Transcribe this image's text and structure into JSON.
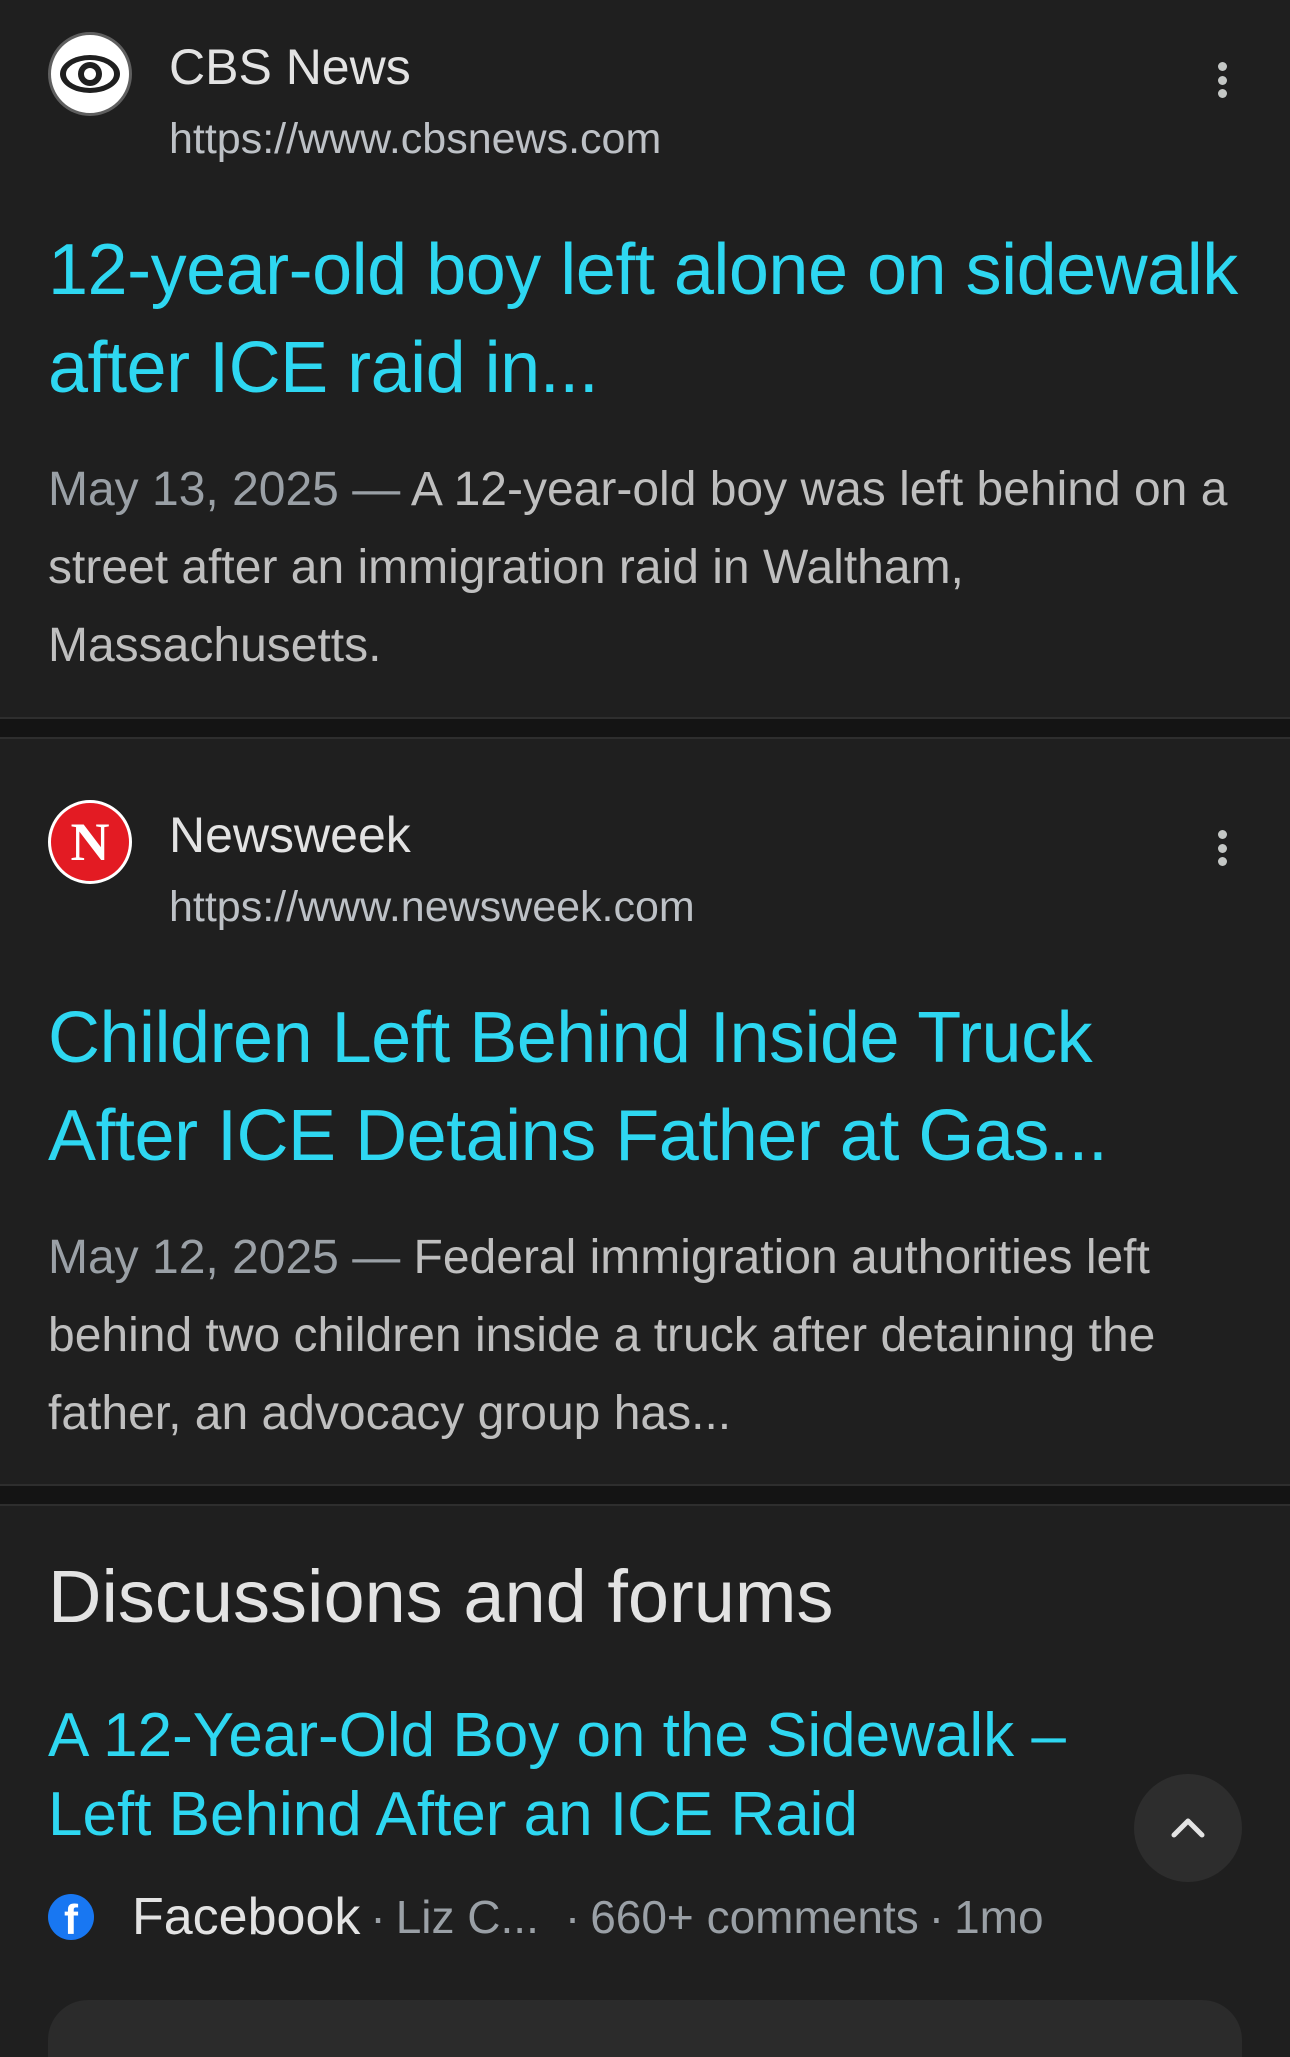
{
  "results": [
    {
      "site_name": "CBS News",
      "url": "https://www.cbsnews.com",
      "favicon_icon": "cbs-eye-icon",
      "title": "12-year-old boy left alone on sidewalk after ICE raid in...",
      "date": "May 13, 2025",
      "dash": " — ",
      "snippet": "A 12-year-old boy was left behind on a street after an immigration raid in Waltham, Massachusetts."
    },
    {
      "site_name": "Newsweek",
      "url": "https://www.newsweek.com",
      "favicon_icon": "newsweek-n-icon",
      "favicon_letter": "N",
      "title": "Children Left Behind Inside Truck After ICE Detains Father at Gas...",
      "date": "May 12, 2025",
      "dash": " — ",
      "snippet": "Federal immigration authorities left behind two children inside a truck after detaining the father, an advocacy group has..."
    }
  ],
  "discussions": {
    "heading": "Discussions and forums",
    "item": {
      "title": "A 12-Year-Old Boy on the Sidewalk – Left Behind After an ICE Raid",
      "platform_icon": "facebook-icon",
      "platform_letter": "f",
      "platform": "Facebook",
      "author": "Liz C...",
      "comments": "660+ comments",
      "age": "1mo",
      "separator": "·"
    }
  },
  "controls": {
    "more_icon": "more-vert-icon",
    "scroll_top_icon": "chevron-up-icon"
  },
  "colors": {
    "background": "#1f1f1f",
    "link": "#2ed7f1",
    "text": "#e3e3e3",
    "muted": "#9aa0a6"
  }
}
